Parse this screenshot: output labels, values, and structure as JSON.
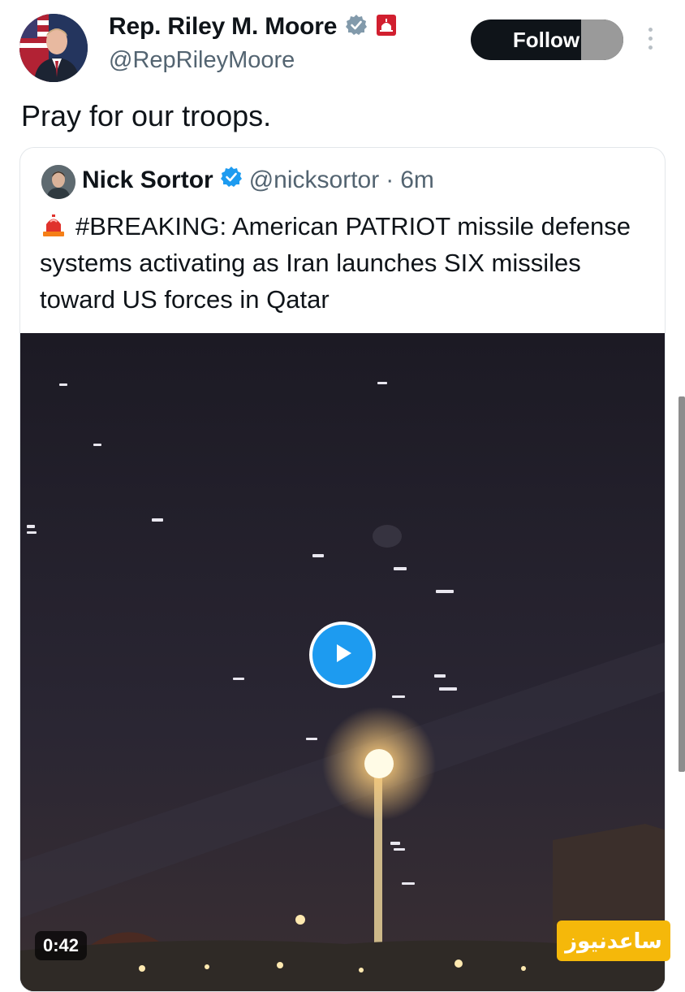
{
  "author": {
    "name": "Rep. Riley M. Moore",
    "handle": "@RepRileyMoore",
    "verified_icon": "verified-badge-icon",
    "affiliation_icon": "capitol-badge-icon"
  },
  "follow_label": "Follow",
  "tweet_text": "Pray for our troops.",
  "quoted": {
    "name": "Nick Sortor",
    "handle": "@nicksortor",
    "separator": "·",
    "time": "6m",
    "text": "#BREAKING: American PATRIOT missile defense systems activating as Iran launches SIX missiles toward US forces in Qatar",
    "emoji_icon": "siren-icon",
    "video": {
      "duration": "0:42",
      "play_icon": "play-icon"
    }
  },
  "watermark": "ساعدنیوز",
  "colors": {
    "accent": "#1d9bf0",
    "text": "#0f1419",
    "muted": "#536471",
    "watermark_bg": "#f5b80a"
  }
}
